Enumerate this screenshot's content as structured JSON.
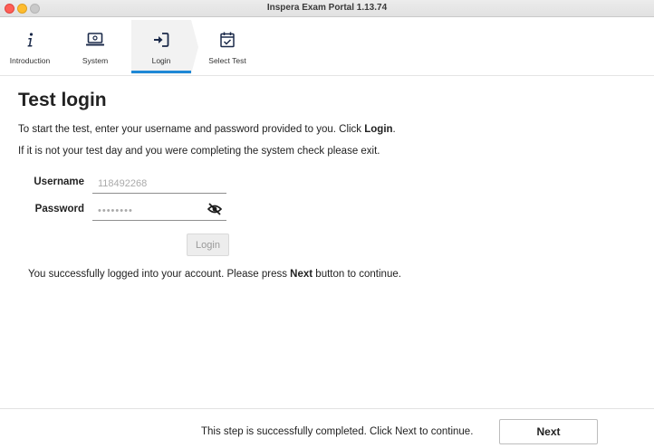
{
  "window": {
    "title": "Inspera Exam Portal 1.13.74"
  },
  "steps": [
    {
      "label": "Introduction",
      "icon": "info-icon"
    },
    {
      "label": "System",
      "icon": "laptop-icon"
    },
    {
      "label": "Login",
      "icon": "login-icon",
      "active": true
    },
    {
      "label": "Select Test",
      "icon": "calendar-check-icon"
    }
  ],
  "main": {
    "title": "Test login",
    "intro_line1_prefix": "To start the test, enter your username and password provided to you. Click ",
    "intro_line1_bold": "Login",
    "intro_line1_suffix": ".",
    "intro_line2": "If it is not your test day and you were completing the system check please exit.",
    "username_label": "Username",
    "username_value": "118492268",
    "password_label": "Password",
    "password_value": "••••••••",
    "login_button": "Login",
    "success_prefix": "You successfully logged into your account. Please press ",
    "success_bold": "Next",
    "success_suffix": " button to continue."
  },
  "footer": {
    "message": "This step is successfully completed. Click Next to continue.",
    "next_button": "Next"
  },
  "colors": {
    "accent": "#1e88d6",
    "active_step_bg": "#f2f2f2",
    "icon_navy": "#1b2a4a"
  }
}
